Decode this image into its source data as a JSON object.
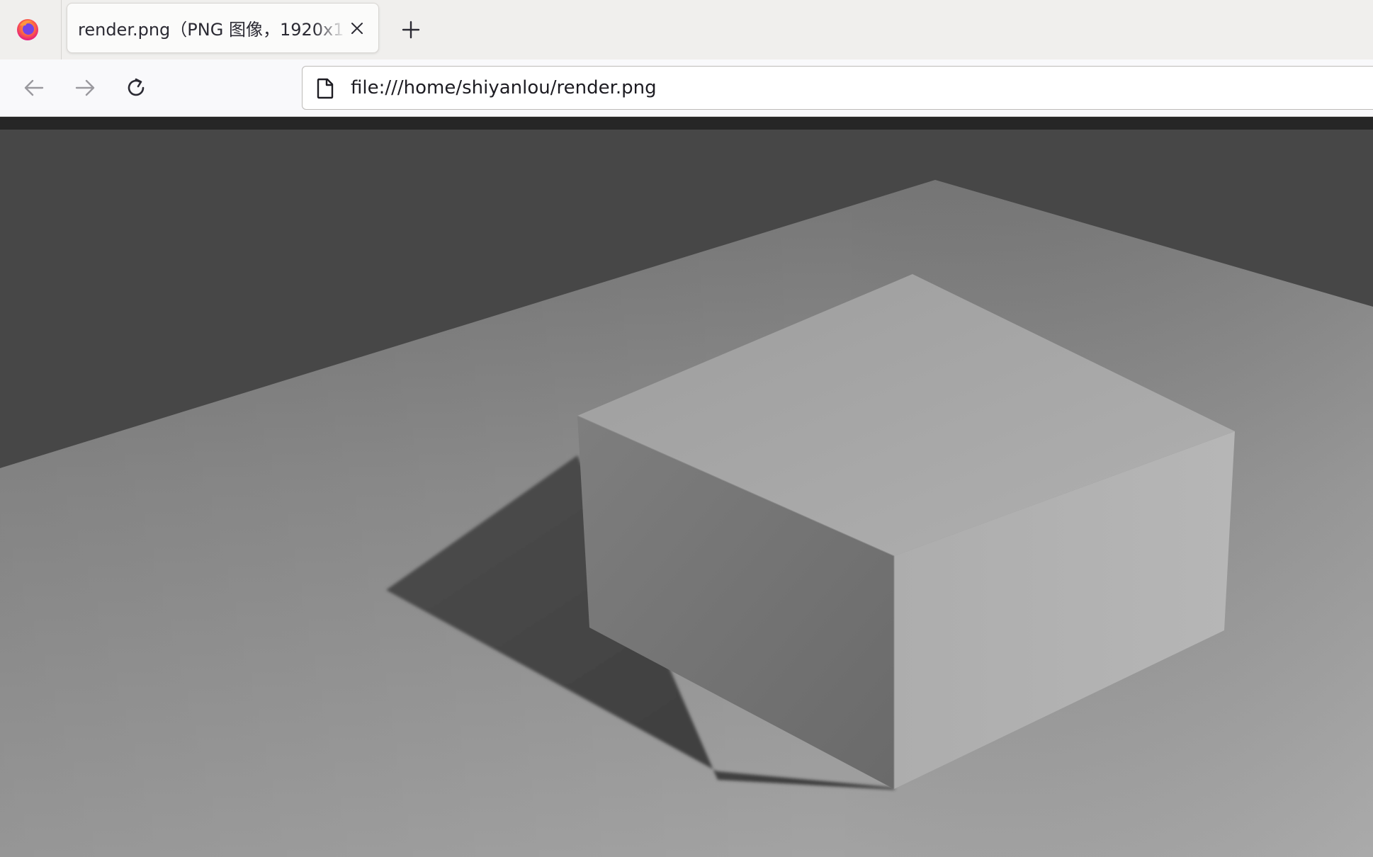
{
  "browser": {
    "tab": {
      "title": "render.png（PNG 图像，1920x1",
      "close_icon": "close-icon"
    },
    "new_tab_icon": "plus-icon",
    "nav": {
      "back_icon": "arrow-left-icon",
      "forward_icon": "arrow-right-icon",
      "reload_icon": "reload-icon"
    },
    "url": {
      "page_icon": "document-icon",
      "value": "file:///home/shiyanlou/render.png"
    }
  },
  "image": {
    "description_icon": "rendered-3d-box-image",
    "colors": {
      "background": "#474747",
      "floor_far": "#7a7a7a",
      "floor_near": "#9e9e9e",
      "box_top": "#a5a5a5",
      "box_left": "#7b7b7b",
      "box_right": "#b3b3b3",
      "shadow": "#4a4a4a"
    }
  }
}
